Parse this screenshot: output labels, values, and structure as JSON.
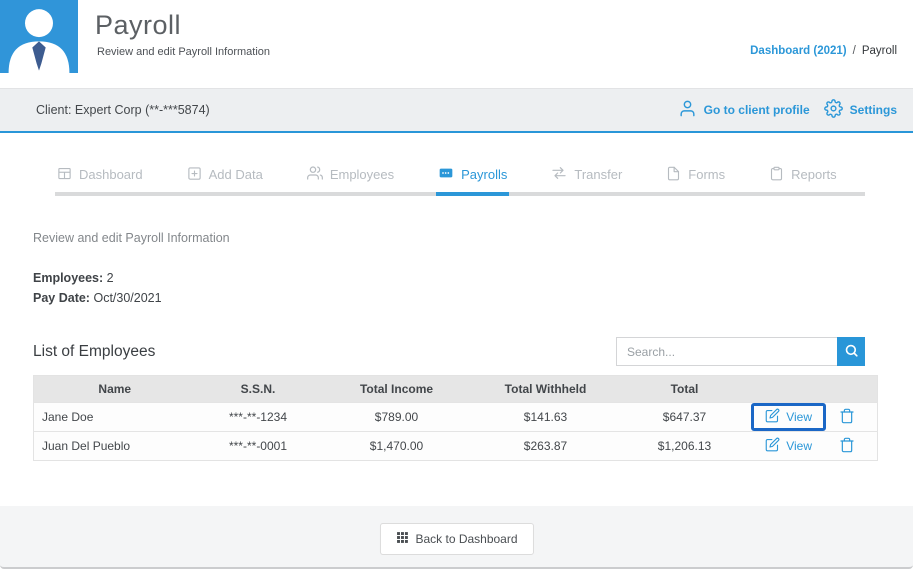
{
  "header": {
    "title": "Payroll",
    "subtitle": "Review and edit Payroll Information",
    "breadcrumb": {
      "link": "Dashboard (2021)",
      "separator": "/",
      "current": "Payroll"
    }
  },
  "client_bar": {
    "client_label": "Client: Expert Corp (**-***5874)",
    "profile_link": "Go to client profile",
    "settings_link": "Settings"
  },
  "tabs": [
    {
      "label": "Dashboard",
      "active": false
    },
    {
      "label": "Add Data",
      "active": false
    },
    {
      "label": "Employees",
      "active": false
    },
    {
      "label": "Payrolls",
      "active": true
    },
    {
      "label": "Transfer",
      "active": false
    },
    {
      "label": "Forms",
      "active": false
    },
    {
      "label": "Reports",
      "active": false
    }
  ],
  "content": {
    "description": "Review and edit Payroll Information",
    "employees_label": "Employees:",
    "employees_value": "2",
    "pay_date_label": "Pay Date:",
    "pay_date_value": "Oct/30/2021",
    "list_title": "List of Employees",
    "search_placeholder": "Search..."
  },
  "table": {
    "columns": [
      "Name",
      "S.S.N.",
      "Total Income",
      "Total Withheld",
      "Total"
    ],
    "rows": [
      {
        "name": "Jane Doe",
        "ssn": "***-**-1234",
        "total_income": "$789.00",
        "total_withheld": "$141.63",
        "total": "$647.37",
        "view_label": "View",
        "highlighted": true
      },
      {
        "name": "Juan Del Pueblo",
        "ssn": "***-**-0001",
        "total_income": "$1,470.00",
        "total_withheld": "$263.87",
        "total": "$1,206.13",
        "view_label": "View",
        "highlighted": false
      }
    ]
  },
  "footer": {
    "back_button": "Back to Dashboard"
  },
  "colors": {
    "accent_blue": "#2b97d8",
    "avatar_background": "#3095d9",
    "highlight_box": "#1b67c6",
    "client_bar_background": "#edeff1",
    "tab_inactive": "#b6bbc0",
    "table_header_background": "#e6e6e6",
    "footer_background": "#f4f5f6"
  }
}
